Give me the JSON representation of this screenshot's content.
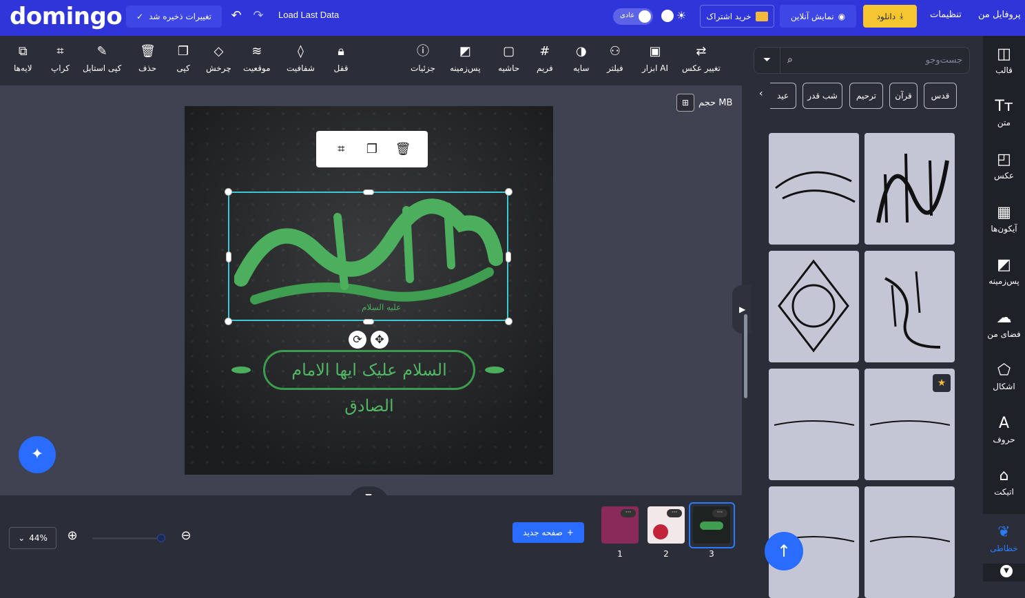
{
  "topbar": {
    "logo": "domingo",
    "saved_label": "تغییرات ذخیره شد",
    "load_last_data": "Load Last Data",
    "mode_toggle_label": "عادی",
    "buy_subscription": "خرید اشتراک",
    "online_preview": "نمایش آنلاین",
    "download": "دانلود",
    "settings": "تنظیمات",
    "profile": "پروفایل من"
  },
  "toolbar": {
    "tools": [
      {
        "name": "layers",
        "label": "لایه‌ها",
        "icon": "layers-icon"
      },
      {
        "name": "crop",
        "label": "کراپ",
        "icon": "crop-icon"
      },
      {
        "name": "copy-style",
        "label": "کپی استایل",
        "icon": "brush-icon"
      },
      {
        "name": "delete",
        "label": "حذف",
        "icon": "trash-icon"
      },
      {
        "name": "copy",
        "label": "کپی",
        "icon": "copy-icon"
      },
      {
        "name": "rotate",
        "label": "چرخش",
        "icon": "rotate-icon"
      },
      {
        "name": "position",
        "label": "موقعیت",
        "icon": "stack-icon"
      },
      {
        "name": "opacity",
        "label": "شفافیت",
        "icon": "drop-icon"
      },
      {
        "name": "lock",
        "label": "قفل",
        "icon": "lock-icon"
      },
      {
        "name": "details",
        "label": "جزئیات",
        "icon": "info-icon"
      },
      {
        "name": "background",
        "label": "پس‌زمینه",
        "icon": "background-icon"
      },
      {
        "name": "border",
        "label": "حاشیه",
        "icon": "square-icon"
      },
      {
        "name": "frame",
        "label": "فریم",
        "icon": "frame-icon"
      },
      {
        "name": "shadow",
        "label": "سایه",
        "icon": "shadow-icon"
      },
      {
        "name": "filter",
        "label": "فیلتر",
        "icon": "filter-circles-icon"
      },
      {
        "name": "ai-tools",
        "label": "ابزار AI",
        "icon": "ai-image-icon"
      },
      {
        "name": "change-image",
        "label": "تغییر عکس",
        "icon": "swap-icon"
      }
    ]
  },
  "canvas": {
    "size_label": "حجم MB",
    "banner_text": "السلام علیک ایها الامام الصادق",
    "main_text": "یا جعفر صادق",
    "small_text": "علیه السلام"
  },
  "bottombar": {
    "zoom": "44%",
    "new_page": "صفحه جدید",
    "pages": [
      "1",
      "2",
      "3"
    ]
  },
  "side_panel": {
    "search_placeholder": "جست‌وجو",
    "chips": [
      "قدس",
      "قرآن",
      "ترحیم",
      "شب قدر",
      "عید"
    ]
  },
  "rail": {
    "items": [
      {
        "label": "قالب",
        "icon": "template-icon"
      },
      {
        "label": "متن",
        "icon": "text-icon"
      },
      {
        "label": "عکس",
        "icon": "image-icon"
      },
      {
        "label": "آیکون‌ها",
        "icon": "grid-icon"
      },
      {
        "label": "پس‌زمینه",
        "icon": "background-icon"
      },
      {
        "label": "فضای من",
        "icon": "upload-cloud-icon"
      },
      {
        "label": "اشکال",
        "icon": "shapes-icon"
      },
      {
        "label": "حروف",
        "icon": "letter-icon"
      },
      {
        "label": "اتیکت",
        "icon": "tag-icon"
      },
      {
        "label": "خطاطی",
        "icon": "feather-icon"
      }
    ]
  },
  "colors": {
    "topbar": "#2f35d8",
    "accent": "#2a6cff",
    "download": "#f5c62f",
    "selection": "#3fc9d6",
    "calligraphy_green": "#4caf5e"
  }
}
